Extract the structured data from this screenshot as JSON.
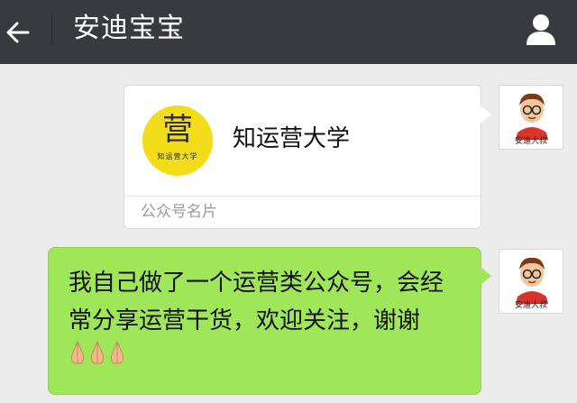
{
  "header": {
    "back_icon": "arrow-left-icon",
    "title": "安迪宝宝",
    "profile_icon": "person-icon"
  },
  "messages": {
    "card": {
      "account_name": "知运营大学",
      "logo_char": "营",
      "logo_subtext": "知运营大学",
      "type_label": "公众号名片"
    },
    "text": {
      "content": "我自己做了一个运营类公众号，会经常分享运营干货，欢迎关注，谢谢",
      "emoji": "folded-hands-icon"
    },
    "sender": {
      "avatar_caption": "安迪大叔"
    }
  },
  "colors": {
    "header_bg": "#393a3f",
    "chat_bg": "#ececec",
    "bubble_green": "#9fe658",
    "logo_yellow": "#f3dc1a"
  }
}
